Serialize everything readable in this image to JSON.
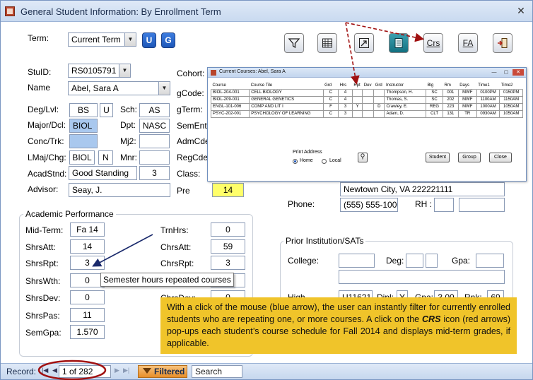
{
  "window": {
    "title": "General Student Information:  By Enrollment Term",
    "close_glyph": "✕"
  },
  "term": {
    "label": "Term:",
    "value": "Current Term",
    "btn_u": "U",
    "btn_g": "G"
  },
  "toolbar": {
    "crs_label": "Crs",
    "fa_label": "FA"
  },
  "student": {
    "stuid_label": "StuID:",
    "stuid_value": "RS0105791",
    "name_label": "Name",
    "name_value": "Abel, Sara A",
    "deg_label": "Deg/Lvl:",
    "deg_value": "BS",
    "lvl_value": "U",
    "sch_label": "Sch:",
    "sch_value": "AS",
    "major_label": "Major/Dcl:",
    "major_value": "BIOL",
    "dpt_label": "Dpt:",
    "dpt_value": "NASC",
    "conc_label": "Conc/Trk:",
    "mj2_label": "Mj2:",
    "lmaj_label": "LMaj/Chg:",
    "lmaj_value": "BIOL",
    "chg_value": "N",
    "mnr_label": "Mnr:",
    "acad_label": "AcadStnd:",
    "acad_value": "Good Standing",
    "acad_code": "3",
    "advisor_label": "Advisor:",
    "advisor_value": "Seay, J."
  },
  "mid": {
    "cohort_label": "Cohort:",
    "gcode_label": "gCode:",
    "gterm_label": "gTerm:",
    "sement_label": "SemEnt:",
    "admcde_label": "AdmCde:",
    "regcde_label": "RegCde:",
    "class_label": "Class:",
    "pre_label": "Pre",
    "pre_value": "14"
  },
  "contact": {
    "city_value": "Newtown City, VA 222221111",
    "phone_label": "Phone:",
    "phone_value": "(555) 555-1000",
    "rh_label": "RH :"
  },
  "prior": {
    "title": "Prior Institution/SATs",
    "college_label": "College:",
    "deg_label": "Deg:",
    "gpa_label": "Gpa:",
    "high_label": "High",
    "high_value": "U11621",
    "dipl_label": "Dipl:",
    "dipl_value": "Y",
    "hgpa_label": "Gpa:",
    "hgpa_value": "3.00",
    "rnk_label": "Rnk:",
    "rnk_value": "69"
  },
  "academic": {
    "title": "Academic Performance",
    "midterm_label": "Mid-Term:",
    "midterm_value": "Fa 14",
    "shrsatt_label": "ShrsAtt:",
    "shrsatt_value": "14",
    "shrsrpt_label": "ShrsRpt:",
    "shrsrpt_value": "3",
    "shrswth_label": "ShrsWth:",
    "shrswth_value": "0",
    "shrsdev_label": "ShrsDev:",
    "shrsdev_value": "0",
    "shrspas_label": "ShrsPas:",
    "shrspas_value": "11",
    "semgpa_label": "SemGpa:",
    "semgpa_value": "1.570",
    "trnhrs_label": "TrnHrs:",
    "trnhrs_value": "0",
    "chrsatt_label": "ChrsAtt:",
    "chrsatt_value": "59",
    "chrsrpt_label": "ChrsRpt:",
    "chrsrpt_value": "3",
    "chrswth_value": "0",
    "chrsdev_label": "ChrsDev:",
    "chrsdev_value": "0"
  },
  "tooltip": "Semester hours repeated courses",
  "popup": {
    "title": "Current Courses:  Abel, Sara A",
    "min_glyph": "—",
    "max_glyph": "▢",
    "close_glyph": "✕",
    "headers": [
      "Course",
      "Course Tile",
      "Grd",
      "Hrs",
      "Rpt",
      "Dev",
      "Grd",
      "Instructor",
      "Blg",
      "Rm",
      "Days",
      "Time1",
      "Time2"
    ],
    "rows": [
      [
        "BIOL-204-001",
        "CELL BIOLOGY",
        "C",
        "4",
        "",
        "",
        "",
        "Thompson, H.",
        "SC",
        "001",
        "MWF",
        "0100PM",
        "0150PM"
      ],
      [
        "BIOL-209-001",
        "GENERAL GENETICS",
        "C",
        "4",
        "",
        "",
        "",
        "Thomas, S.",
        "SC",
        "202",
        "MWF",
        "1100AM",
        "1150AM"
      ],
      [
        "ENGL-101-006",
        "COMP AND LIT I",
        "F",
        "3",
        "Y",
        "",
        "D",
        "Crawley, E.",
        "REG",
        "223",
        "MWF",
        "1000AM",
        "1050AM"
      ],
      [
        "PSYC-202-001",
        "PSYCHOLOGY OF LEARNING",
        "C",
        "3",
        "",
        "",
        "",
        "Adam, D.",
        "CLT",
        "131",
        "TR",
        "0930AM",
        "1050AM"
      ]
    ],
    "print_address_label": "Print Address",
    "home_label": "Home",
    "local_label": "Local",
    "student_btn": "Student",
    "group_btn": "Group",
    "close_btn": "Close"
  },
  "callout": {
    "text_1": "With a click of the mouse (blue arrow), the user can instantly filter for currently enrolled students who are repeating one, or more courses.  A click on the ",
    "text_crs": "CRS",
    "text_2": " icon (red arrows) pop-ups each student’s course schedule for Fall 2014 and displays mid-term grades, if applicable."
  },
  "statusbar": {
    "record_label": "Record:",
    "record_value": "1 of 282",
    "filtered_label": "Filtered",
    "search_label": "Search"
  },
  "colors": {
    "accent": "#1e57b8",
    "callout": "#f0c42a",
    "pre_field": "#ffff6a",
    "highlight_field": "#a9c8ee",
    "annotation_red": "#a01010",
    "annotation_blue": "#1a2a6c"
  }
}
